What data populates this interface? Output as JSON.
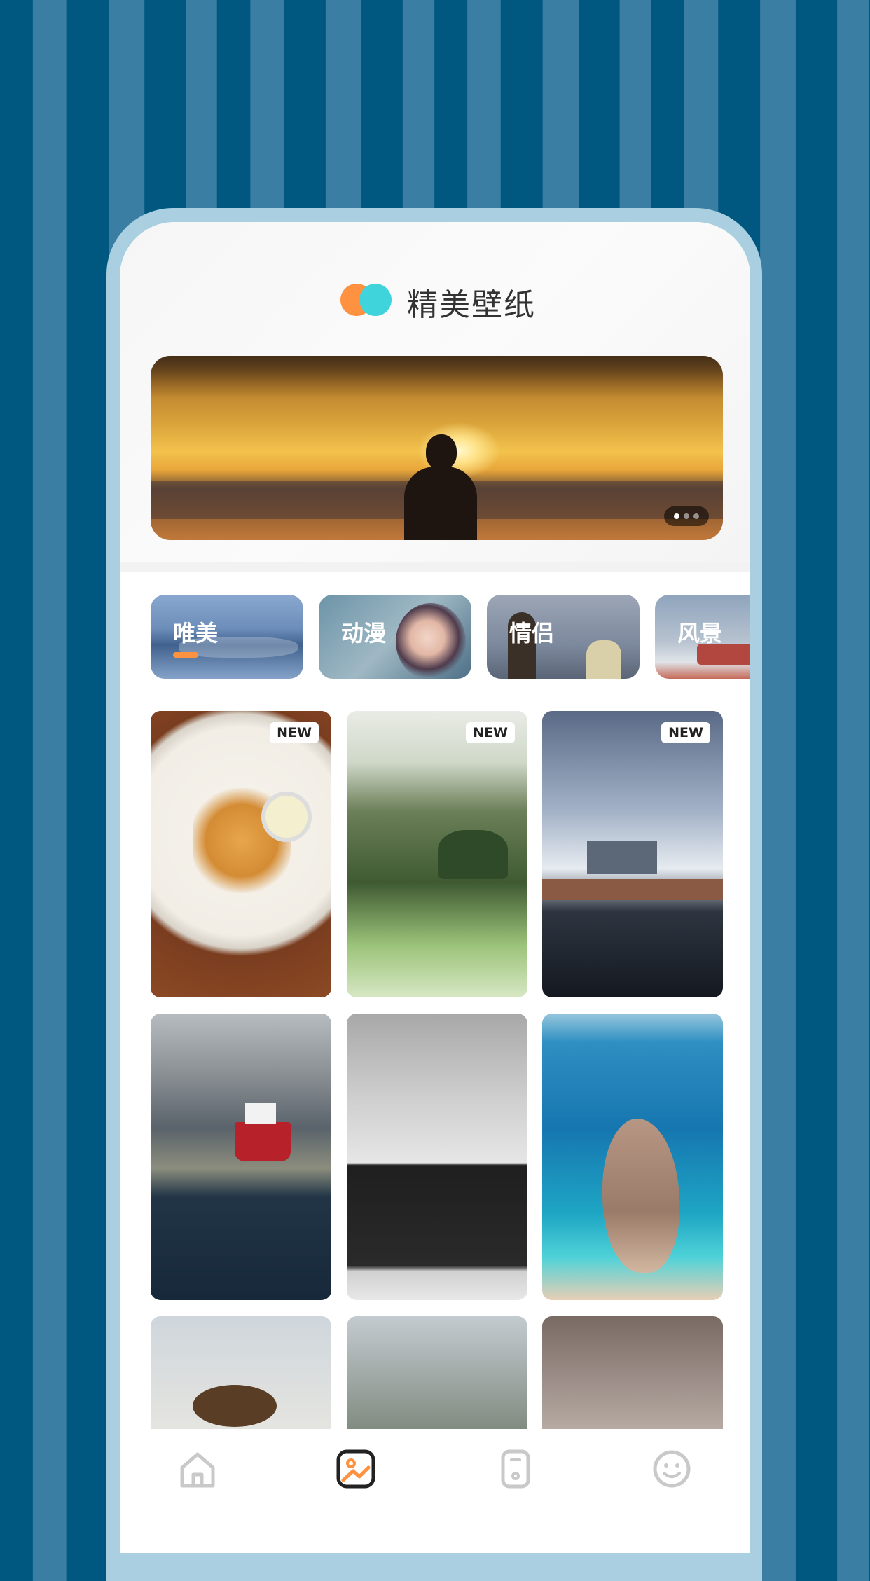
{
  "app": {
    "title": "精美壁纸",
    "logo_colors": [
      "#ff9240",
      "#3fd3dc"
    ]
  },
  "banner": {
    "page_count": 3,
    "active_page": 1
  },
  "categories": [
    {
      "label": "唯美",
      "selected": true
    },
    {
      "label": "动漫",
      "selected": false
    },
    {
      "label": "情侣",
      "selected": false
    },
    {
      "label": "风景",
      "selected": false
    }
  ],
  "grid": {
    "tiles": [
      {
        "badge": "NEW"
      },
      {
        "badge": "NEW"
      },
      {
        "badge": "NEW"
      },
      {
        "badge": ""
      },
      {
        "badge": ""
      },
      {
        "badge": ""
      },
      {
        "badge": ""
      },
      {
        "badge": ""
      },
      {
        "badge": ""
      }
    ]
  },
  "tabbar": {
    "items": [
      {
        "icon": "home-icon",
        "active": false
      },
      {
        "icon": "wallpaper-icon",
        "active": true
      },
      {
        "icon": "phone-icon",
        "active": false
      },
      {
        "icon": "smiley-icon",
        "active": false
      }
    ],
    "accent_color": "#ff9240",
    "inactive_color": "#c9c9c9"
  }
}
